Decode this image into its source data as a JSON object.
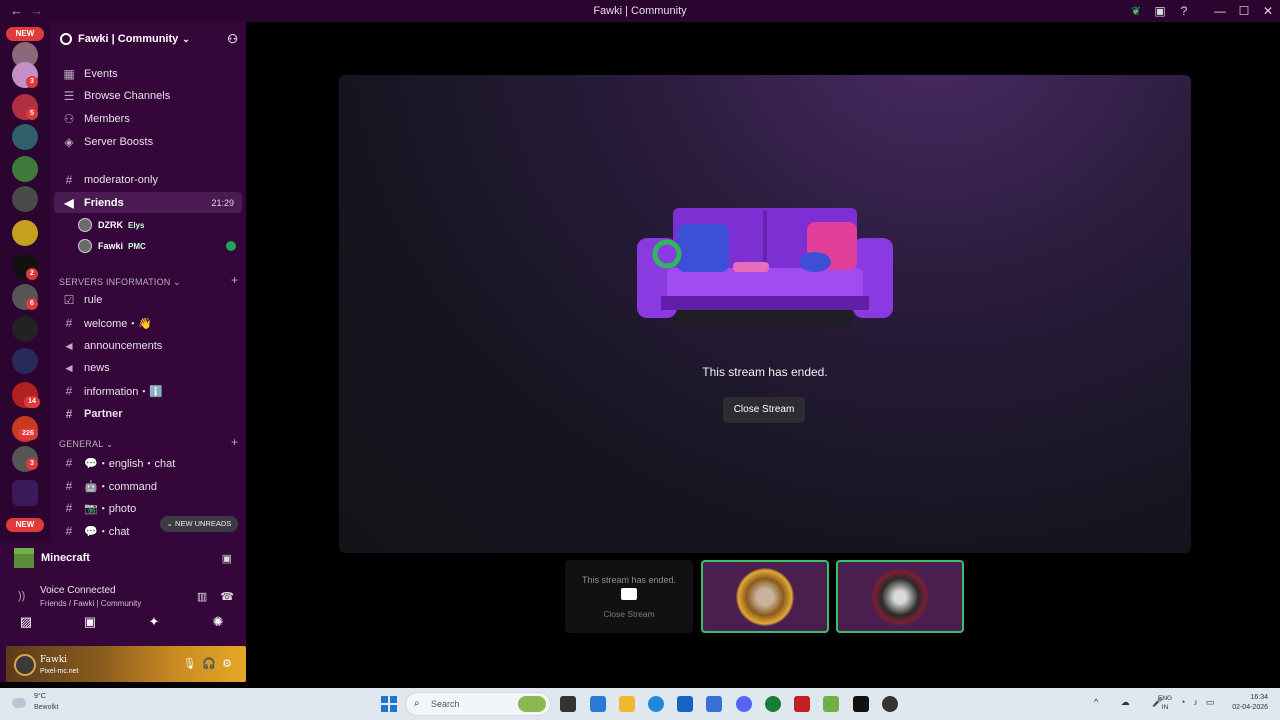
{
  "window": {
    "title": "Fawki | Community"
  },
  "guilds": {
    "new_pill": "NEW",
    "badges": [
      "3",
      "5",
      "2",
      "6",
      "14",
      "226",
      "3"
    ]
  },
  "server": {
    "name": "Fawki | Community",
    "nav": [
      "Events",
      "Browse Channels",
      "Members",
      "Server Boosts"
    ],
    "channels_top": [
      {
        "name": "moderator-only",
        "icon": "#"
      },
      {
        "name": "Friends",
        "icon": "voice",
        "time": "21:29"
      }
    ],
    "voice_users": [
      {
        "name": "DZRK",
        "tag": "Elys"
      },
      {
        "name": "Fawki",
        "tag": "PMC"
      }
    ],
    "cat_info": "SERVERS INFORMATION",
    "info_channels": [
      {
        "name": "rule",
        "icon": "rule"
      },
      {
        "name": "welcome・👋",
        "icon": "#"
      },
      {
        "name": "announcements",
        "icon": "announce"
      },
      {
        "name": "news",
        "icon": "announce"
      },
      {
        "name": "information・ℹ️",
        "icon": "#"
      },
      {
        "name": "Partner",
        "icon": "#"
      }
    ],
    "cat_general": "GENERAL",
    "general_channels": [
      {
        "name": "💬・english・chat",
        "icon": "#"
      },
      {
        "name": "🤖・command",
        "icon": "#"
      },
      {
        "name": "📷・photo",
        "icon": "#"
      },
      {
        "name": "💬・chat",
        "icon": "#"
      }
    ],
    "new_unreads": "NEW UNREADS"
  },
  "panel": {
    "activity": "Minecraft",
    "voice_status": "Voice Connected",
    "voice_location": "Friends / Fawki | Community",
    "user_name": "Fawki",
    "user_status": "Pixel-mc.net"
  },
  "stream": {
    "ended_text": "This stream has ended.",
    "close_label": "Close Stream",
    "tile_ended": "This stream has ended.",
    "tile_close": "Close Stream"
  },
  "taskbar": {
    "temp": "9°C",
    "weather": "Bewolkt",
    "search_placeholder": "Search",
    "lang1": "ENG",
    "lang2": "IN",
    "time": "16:34",
    "date": "02-04-2026"
  }
}
